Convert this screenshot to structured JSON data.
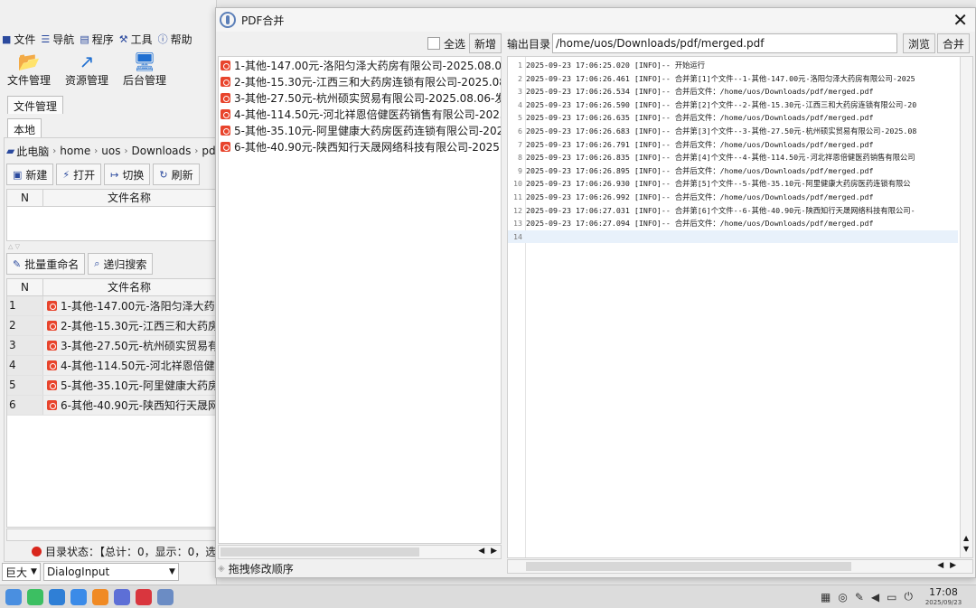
{
  "bg_app": {
    "menu": [
      {
        "icon": "file-icon",
        "glyph": "■",
        "label": "文件"
      },
      {
        "icon": "nav-icon",
        "glyph": "☰",
        "label": "导航"
      },
      {
        "icon": "program-icon",
        "glyph": "▤",
        "label": "程序"
      },
      {
        "icon": "tools-icon",
        "glyph": "⚒",
        "label": "工具"
      },
      {
        "icon": "help-icon",
        "glyph": "ⓘ",
        "label": "帮助"
      }
    ],
    "big_tools": [
      {
        "icon": "folder-icon",
        "glyph": "📂",
        "label": "文件管理"
      },
      {
        "icon": "resource-icon",
        "glyph": "↗",
        "label": "资源管理"
      },
      {
        "icon": "monitor-icon",
        "glyph": "🖥",
        "label": "后台管理"
      }
    ],
    "tab_outer": "文件管理",
    "tab_inner": "本地",
    "breadcrumb": [
      "此电脑",
      "home",
      "uos",
      "Downloads",
      "pdf"
    ],
    "toolbar1": [
      {
        "icon": "new-icon",
        "glyph": "▣",
        "label": "新建"
      },
      {
        "icon": "open-icon",
        "glyph": "⚡",
        "label": "打开"
      },
      {
        "icon": "switch-icon",
        "glyph": "↦",
        "label": "切换"
      },
      {
        "icon": "refresh-icon",
        "glyph": "↻",
        "label": "刷新"
      }
    ],
    "grid1_headers": [
      "N",
      "文件名称"
    ],
    "toolbar2": [
      {
        "icon": "rename-icon",
        "glyph": "✎",
        "label": "批量重命名"
      },
      {
        "icon": "search-icon",
        "glyph": "⌕",
        "label": "递归搜索"
      }
    ],
    "grid2_headers": [
      "N",
      "文件名称"
    ],
    "rows": [
      {
        "n": "1",
        "name": "1-其他-147.00元-洛阳匀泽大药房"
      },
      {
        "n": "2",
        "name": "2-其他-15.30元-江西三和大药房连"
      },
      {
        "n": "3",
        "name": "3-其他-27.50元-杭州硕实贸易有限"
      },
      {
        "n": "4",
        "name": "4-其他-114.50元-河北祥恩倍健医"
      },
      {
        "n": "5",
        "name": "5-其他-35.10元-阿里健康大药房医"
      },
      {
        "n": "6",
        "name": "6-其他-40.90元-陕西知行天晟网络"
      }
    ],
    "status": "目录状态：【总计：0，显示：0，选",
    "size_combo": "巨大",
    "font_combo": "DialogInput"
  },
  "dialog": {
    "title": "PDF合并",
    "select_all": "全选",
    "add_button": "新增",
    "files": [
      "1-其他-147.00元-洛阳匀泽大药房有限公司-2025.08.06-发票",
      "2-其他-15.30元-江西三和大药房连锁有限公司-2025.08.06",
      "3-其他-27.50元-杭州硕实贸易有限公司-2025.08.06-发票",
      "4-其他-114.50元-河北祥恩倍健医药销售有限公司-2025.08",
      "5-其他-35.10元-阿里健康大药房医药连锁有限公司-2025",
      "6-其他-40.90元-陕西知行天晟网络科技有限公司-2025.08"
    ],
    "drag_hint": "拖拽修改顺序",
    "output_label": "输出目录",
    "output_path": "/home/uos/Downloads/pdf/merged.pdf",
    "browse_button": "浏览",
    "merge_button": "合并",
    "log": [
      {
        "n": "1",
        "text": "2025-09-23 17:06:25.020 [INFO]-- 开始运行"
      },
      {
        "n": "2",
        "text": "2025-09-23 17:06:26.461 [INFO]-- 合并第[1]个文件--1-其他-147.00元-洛阳匀泽大药房有限公司-2025"
      },
      {
        "n": "3",
        "text": "2025-09-23 17:06:26.534 [INFO]-- 合并后文件：/home/uos/Downloads/pdf/merged.pdf"
      },
      {
        "n": "4",
        "text": "2025-09-23 17:06:26.590 [INFO]-- 合并第[2]个文件--2-其他-15.30元-江西三和大药房连锁有限公司-20"
      },
      {
        "n": "5",
        "text": "2025-09-23 17:06:26.635 [INFO]-- 合并后文件：/home/uos/Downloads/pdf/merged.pdf"
      },
      {
        "n": "6",
        "text": "2025-09-23 17:06:26.683 [INFO]-- 合并第[3]个文件--3-其他-27.50元-杭州硕实贸易有限公司-2025.08"
      },
      {
        "n": "7",
        "text": "2025-09-23 17:06:26.791 [INFO]-- 合并后文件：/home/uos/Downloads/pdf/merged.pdf"
      },
      {
        "n": "8",
        "text": "2025-09-23 17:06:26.835 [INFO]-- 合并第[4]个文件--4-其他-114.50元-河北祥恩倍健医药销售有限公司"
      },
      {
        "n": "9",
        "text": "2025-09-23 17:06:26.895 [INFO]-- 合并后文件：/home/uos/Downloads/pdf/merged.pdf"
      },
      {
        "n": "10",
        "text": "2025-09-23 17:06:26.930 [INFO]-- 合并第[5]个文件--5-其他-35.10元-阿里健康大药房医药连锁有限公"
      },
      {
        "n": "11",
        "text": "2025-09-23 17:06:26.992 [INFO]-- 合并后文件：/home/uos/Downloads/pdf/merged.pdf"
      },
      {
        "n": "12",
        "text": "2025-09-23 17:06:27.031 [INFO]-- 合并第[6]个文件--6-其他-40.90元-陕西知行天晟网络科技有限公司-"
      },
      {
        "n": "13",
        "text": "2025-09-23 17:06:27.094 [INFO]-- 合并后文件：/home/uos/Downloads/pdf/merged.pdf"
      },
      {
        "n": "14",
        "text": ""
      }
    ]
  },
  "taskbar": {
    "time": "17:08",
    "date": "2025/09/23",
    "apps": [
      {
        "name": "launcher-icon",
        "color": "#4a8fe0"
      },
      {
        "name": "terminal-icon",
        "color": "#3cbf62"
      },
      {
        "name": "store-icon",
        "color": "#2f7fd6"
      },
      {
        "name": "browser-icon",
        "color": "#3b8be8"
      },
      {
        "name": "files-icon",
        "color": "#f08a24"
      },
      {
        "name": "settings-icon",
        "color": "#5d6fd6"
      },
      {
        "name": "pdf-app-icon",
        "color": "#d9363e"
      },
      {
        "name": "pdfmerge-app-icon",
        "color": "#6b8cc4"
      }
    ]
  }
}
